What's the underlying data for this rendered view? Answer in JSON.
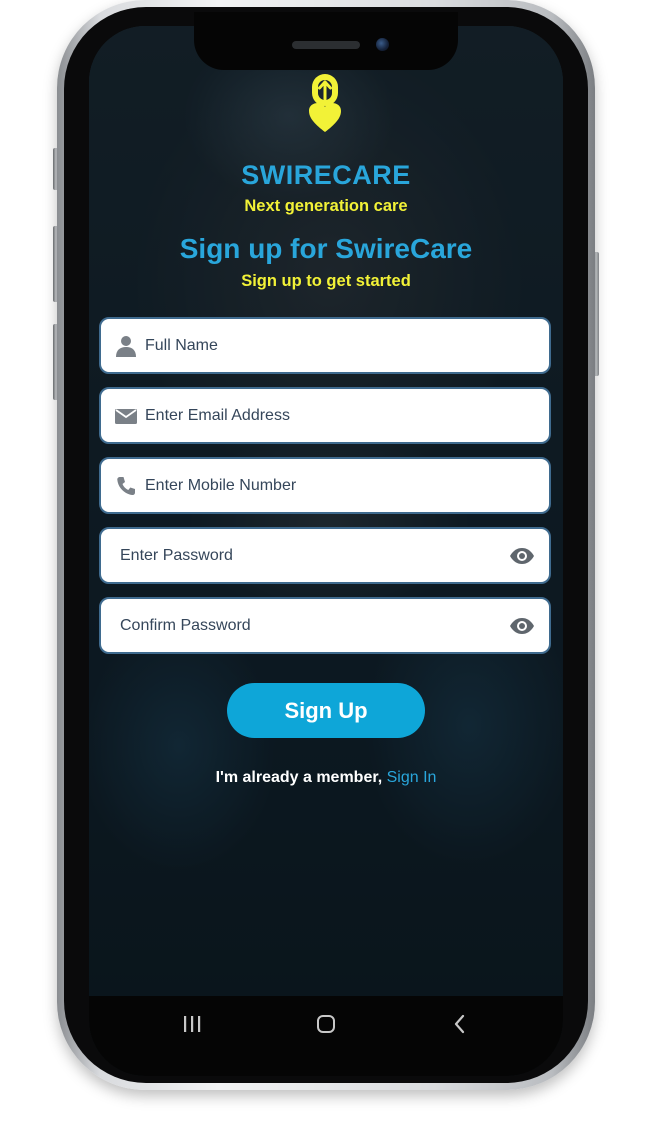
{
  "app": {
    "brand_name": "SWIRECARE",
    "tagline": "Next generation care"
  },
  "signup": {
    "title": "Sign up for SwireCare",
    "subtitle": "Sign up to get started",
    "fields": {
      "full_name": {
        "placeholder": "Full Name",
        "icon": "person-icon"
      },
      "email": {
        "placeholder": "Enter Email Address",
        "icon": "envelope-icon"
      },
      "mobile": {
        "placeholder": "Enter Mobile Number",
        "icon": "phone-icon"
      },
      "password": {
        "placeholder": "Enter Password",
        "icon": "eye-icon"
      },
      "confirm_password": {
        "placeholder": "Confirm Password",
        "icon": "eye-icon"
      }
    },
    "submit_label": "Sign Up",
    "member_text": "I'm already a member,",
    "sign_in_label": "Sign In"
  },
  "nav": {
    "recent_icon": "recent-apps-icon",
    "home_icon": "home-icon",
    "back_icon": "back-icon"
  },
  "colors": {
    "brand_blue": "#29a6db",
    "accent_yellow": "#f2f237",
    "button_blue": "#0ea6d8",
    "field_border": "#3f6b8f"
  }
}
